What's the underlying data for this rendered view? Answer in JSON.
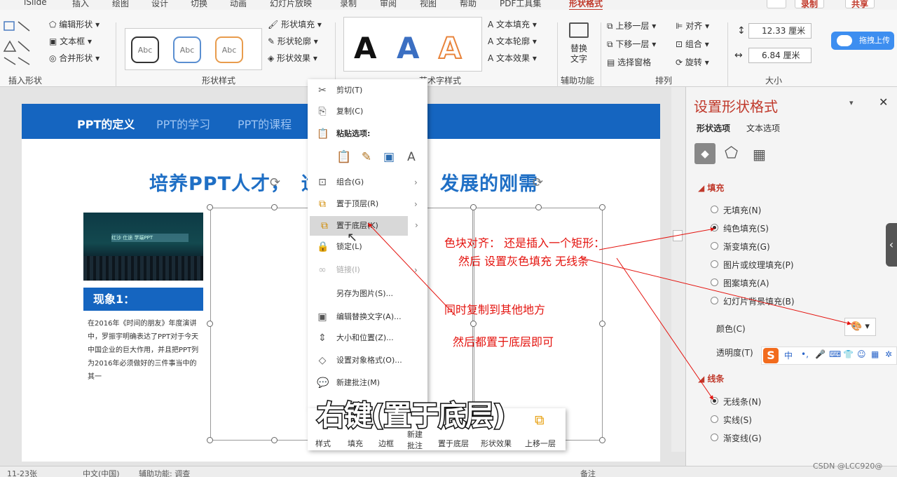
{
  "ribbon": {
    "tabs": [
      "iSlide",
      "插入",
      "绘图",
      "设计",
      "切换",
      "动画",
      "幻灯片放映",
      "录制",
      "审阅",
      "视图",
      "帮助",
      "PDF工具集",
      "形状格式"
    ],
    "top_right": {
      "record": "录制",
      "share": "共享"
    },
    "insert_shape": {
      "edit_shape": "编辑形状",
      "text_box": "文本框",
      "merge_shapes": "合并形状",
      "title": "插入形状"
    },
    "shape_styles": {
      "sample": "Abc",
      "fill": "形状填充",
      "outline": "形状轮廓",
      "effects": "形状效果",
      "title": "形状样式"
    },
    "wordart": {
      "letter": "A",
      "text_fill": "文本填充",
      "text_outline": "文本轮廓",
      "text_effects": "文本效果",
      "title": "艺术字样式"
    },
    "accessibility": {
      "alt_text": "替换\n文字",
      "title": "辅助功能"
    },
    "arrange": {
      "bring_forward": "上移一层",
      "send_backward": "下移一层",
      "selection_pane": "选择窗格",
      "align": "对齐",
      "group": "组合",
      "rotate": "旋转",
      "title": "排列"
    },
    "size": {
      "height": "12.33 厘米",
      "width": "6.84 厘米",
      "title": "大小"
    },
    "upload": "拖拽上传"
  },
  "slide": {
    "nav": [
      "PPT的定义",
      "PPT的学习",
      "PPT的课程"
    ],
    "title": "培养PPT人才，适应时代发展的刚需",
    "title_left": "培养PPT人才",
    "title_frag": "适",
    "title_right": "发展的刚需",
    "photo_banner": "红沙  仕途  学端PPT",
    "phenomenon": "现象1：",
    "paragraph": "在2016年《时间的朋友》年度演讲中，罗振宇明确表达了PPT对于今天中国企业的巨大作用，并且把PPT列为2016年必须做好的三件事当中的其一"
  },
  "context_menu": {
    "items": [
      {
        "label": "剪切(T)",
        "icon": "scissors-icon"
      },
      {
        "label": "复制(C)",
        "icon": "copy-icon"
      },
      {
        "label": "粘贴选项:",
        "icon": "paste-icon"
      },
      {
        "label": "组合(G)",
        "icon": "group-icon"
      },
      {
        "label": "置于顶层(R)",
        "icon": "bring-front-icon"
      },
      {
        "label": "置于底层(K)",
        "icon": "send-back-icon"
      },
      {
        "label": "锁定(L)",
        "icon": "lock-icon"
      },
      {
        "label": "链接(I)",
        "icon": "link-icon"
      },
      {
        "label": "另存为图片(S)...",
        "icon": ""
      },
      {
        "label": "编辑替换文字(A)...",
        "icon": "alt-text-icon"
      },
      {
        "label": "大小和位置(Z)...",
        "icon": "size-icon"
      },
      {
        "label": "设置对象格式(O)...",
        "icon": "format-icon"
      },
      {
        "label": "新建批注(M)",
        "icon": "comment-icon"
      }
    ],
    "mini_toolbar": [
      "样式",
      "填充",
      "边框",
      "新建\n批注",
      "置于底层",
      "形状效果",
      "上移一层"
    ]
  },
  "caption": "右键(置于底层)",
  "annotations": {
    "a1": "色块对齐：  还是插入一个矩形：",
    "a2": "然后  设置灰色填充  无线条",
    "a3": "同时复制到其他地方",
    "a4": "然后都置于底层即可"
  },
  "format_pane": {
    "title": "设置形状格式",
    "tabs": [
      "形状选项",
      "文本选项"
    ],
    "fill_section": "填充",
    "fill_options": [
      "无填充(N)",
      "纯色填充(S)",
      "渐变填充(G)",
      "图片或纹理填充(P)",
      "图案填充(A)",
      "幻灯片背景填充(B)"
    ],
    "fill_selected": 1,
    "color_label": "颜色(C)",
    "transparency_label": "透明度(T)",
    "line_section": "线条",
    "line_options": [
      "无线条(N)",
      "实线(S)",
      "渐变线(G)"
    ],
    "line_selected": 0
  },
  "ime_bar": {
    "mode": "中"
  },
  "status": {
    "slide": "11-23张",
    "lang": "中文(中国)",
    "access": "辅助功能: 调查",
    "notes": "备注",
    "watermark": "CSDN @LCC920@"
  },
  "colors": {
    "accent": "#c0392b",
    "blue": "#1565c0",
    "annotation": "#e4130e"
  }
}
